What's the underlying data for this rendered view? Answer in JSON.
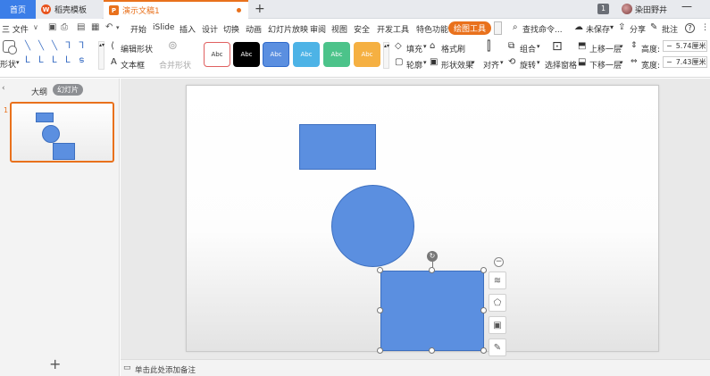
{
  "tabs": {
    "home": "首页",
    "templates": "稻壳模板",
    "document": "演示文稿1",
    "add": "+"
  },
  "titlebar": {
    "badge": "1",
    "username": "染田野井",
    "minimize": "—"
  },
  "menu": {
    "file": "三 文件",
    "items": [
      "开始",
      "iSlide",
      "插入",
      "设计",
      "切换",
      "动画",
      "幻灯片放映",
      "审阅",
      "视图",
      "安全",
      "开发工具",
      "特色功能"
    ],
    "active": "绘图工具",
    "search": "查找命令...",
    "unsaved": "未保存",
    "share": "分享",
    "comment": "批注",
    "help": "?",
    "more": "⋮"
  },
  "ribbon": {
    "shape": "形状",
    "edit_shape": "编辑形状",
    "textbox": "文本框",
    "merge_shape": "合并形状",
    "styles": [
      {
        "label": "Abc",
        "bg": "#ffffff",
        "fg": "#333333",
        "border": "#e06060"
      },
      {
        "label": "Abc",
        "bg": "#000000",
        "fg": "#ffffff",
        "border": "#000000"
      },
      {
        "label": "Abc",
        "bg": "#5b8fe0",
        "fg": "#ffffff",
        "border": "#2f6acb"
      },
      {
        "label": "Abc",
        "bg": "#4db3e6",
        "fg": "#ffffff",
        "border": "#4db3e6"
      },
      {
        "label": "Abc",
        "bg": "#4cc38a",
        "fg": "#ffffff",
        "border": "#4cc38a"
      },
      {
        "label": "Abc",
        "bg": "#f5b042",
        "fg": "#ffffff",
        "border": "#f5b042"
      }
    ],
    "fill": "填充",
    "format_painter": "格式刷",
    "outline": "轮廓",
    "shape_effect": "形状效果",
    "align": "对齐",
    "group": "组合",
    "rotate": "旋转",
    "selection_pane": "选择窗格",
    "bring_forward": "上移一层",
    "send_backward": "下移一层",
    "height_label": "高度:",
    "height_value": "5.74厘米",
    "width_label": "宽度:",
    "width_value": "7.43厘米"
  },
  "leftpanel": {
    "outline": "大纲",
    "slides": "幻灯片",
    "slide_number": "1",
    "add": "+"
  },
  "notes": {
    "placeholder": "单击此处添加备注"
  }
}
